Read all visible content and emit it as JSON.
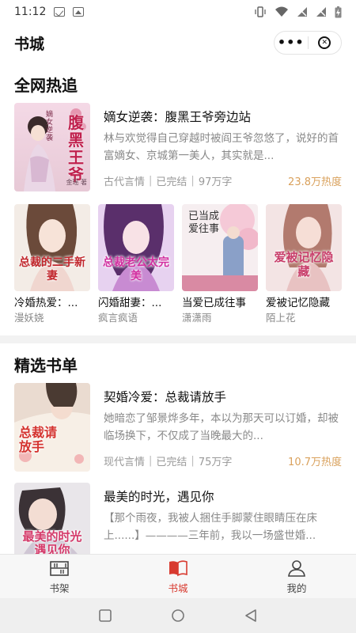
{
  "status_bar": {
    "time": "11:12"
  },
  "header": {
    "title": "书城",
    "more_icon": "more-dots-icon",
    "close_icon": "close-circle-icon"
  },
  "sections": {
    "hot": {
      "title": "全网热追",
      "featured": {
        "title": "嫡女逆袭：腹黑王爷旁边站",
        "desc": "林与欢觉得自己穿越时被阎王爷忽悠了，说好的首富嫡女、京城第一美人，其实就是...",
        "genre": "古代言情",
        "status": "已完结",
        "words": "97万字",
        "heat": "23.8万热度",
        "cover_title": "腹黑王爷",
        "cover_sub": "嫡女逆袭",
        "cover_author": "金瑶 著"
      },
      "grid": [
        {
          "title": "冷婚热爱：...",
          "author": "漫妖娆",
          "cover_text": "总裁的二手新妻"
        },
        {
          "title": "闪婚甜妻：...",
          "author": "疯言疯语",
          "cover_text": "总裁老公太完美"
        },
        {
          "title": "当爱已成往事",
          "author": "潇潇雨",
          "cover_text": "已当成爱往事"
        },
        {
          "title": "爱被记忆隐藏",
          "author": "陌上花",
          "cover_text": "爱被记忆隐藏"
        }
      ]
    },
    "picks": {
      "title": "精选书单",
      "books": [
        {
          "title": "契婚冷爱：总裁请放手",
          "desc": "她暗恋了邹景烨多年，本以为那天可以订婚，却被临场换下，不仅成了当晚最大的...",
          "genre": "现代言情",
          "status": "已完结",
          "words": "75万字",
          "heat": "10.7万热度",
          "cover_text": "总裁请放手"
        },
        {
          "title": "最美的时光，遇见你",
          "desc": "【那个雨夜，我被人捆住手脚蒙住眼睛压在床上......】————三年前，我以一场盛世婚...",
          "cover_text": "最美的时光遇见你"
        }
      ]
    }
  },
  "tabs": [
    {
      "label": "书架",
      "icon": "bookshelf-icon",
      "active": false
    },
    {
      "label": "书城",
      "icon": "open-book-icon",
      "active": true
    },
    {
      "label": "我的",
      "icon": "user-icon",
      "active": false
    }
  ],
  "colors": {
    "accent": "#d83a2f",
    "heat": "#d9a15c",
    "muted": "#999999"
  }
}
